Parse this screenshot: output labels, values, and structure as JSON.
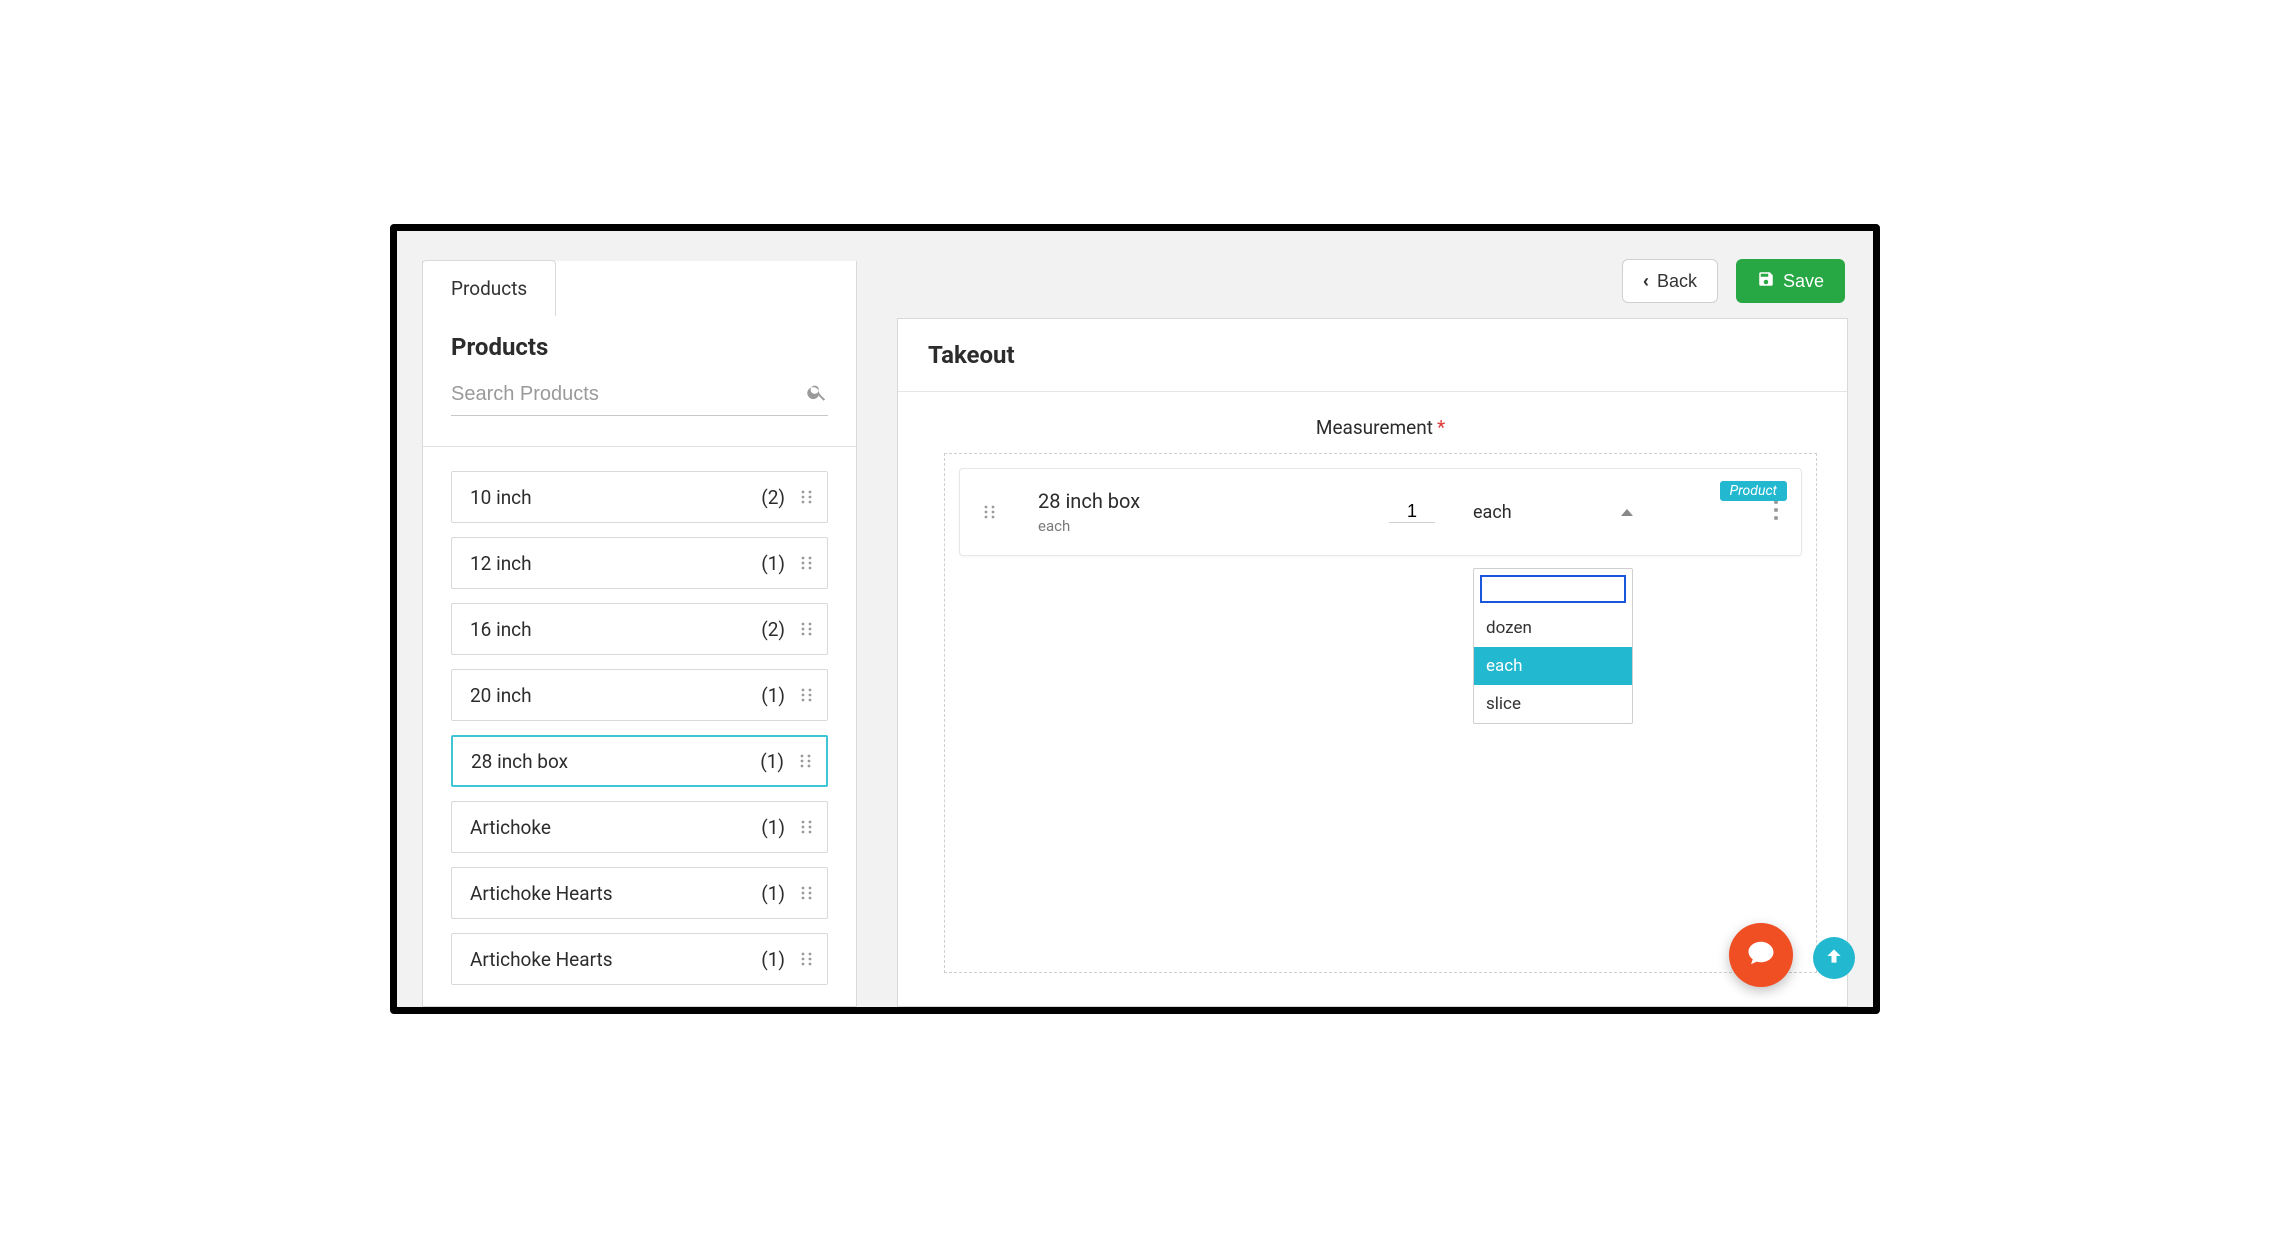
{
  "actions": {
    "back": "Back",
    "save": "Save"
  },
  "tabs": {
    "products": "Products"
  },
  "sidebar": {
    "title": "Products",
    "search_placeholder": "Search Products",
    "items": [
      {
        "name": "10 inch",
        "count": "(2)",
        "selected": false
      },
      {
        "name": "12 inch",
        "count": "(1)",
        "selected": false
      },
      {
        "name": "16 inch",
        "count": "(2)",
        "selected": false
      },
      {
        "name": "20 inch",
        "count": "(1)",
        "selected": false
      },
      {
        "name": "28 inch box",
        "count": "(1)",
        "selected": true
      },
      {
        "name": "Artichoke",
        "count": "(1)",
        "selected": false
      },
      {
        "name": "Artichoke Hearts",
        "count": "(1)",
        "selected": false
      },
      {
        "name": "Artichoke Hearts",
        "count": "(1)",
        "selected": false
      }
    ]
  },
  "main": {
    "title": "Takeout",
    "measurement_label": "Measurement",
    "required_mark": "*",
    "card": {
      "badge": "Product",
      "name": "28 inch box",
      "unit": "each",
      "qty": "1",
      "select_value": "each",
      "options": [
        "dozen",
        "each",
        "slice"
      ],
      "highlighted_option": "each"
    }
  }
}
